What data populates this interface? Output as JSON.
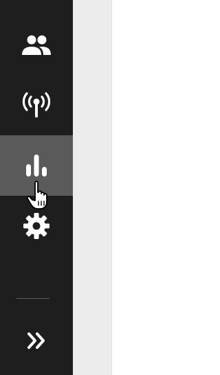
{
  "nav": {
    "items": [
      {
        "id": "users",
        "icon": "people-icon",
        "active": false
      },
      {
        "id": "broadcast",
        "icon": "antenna-icon",
        "active": false
      },
      {
        "id": "analytics",
        "icon": "bar-chart-icon",
        "active": true
      },
      {
        "id": "settings",
        "icon": "gear-icon",
        "active": false
      }
    ],
    "expand": {
      "icon": "double-chevron-right-icon"
    }
  },
  "colors": {
    "rail_background": "#1e1e1e",
    "active_item": "#5a5a5a",
    "icon": "#ffffff",
    "side_panel": "#ececec",
    "content": "#ffffff"
  },
  "cursor": {
    "icon": "hand-pointer-icon"
  }
}
